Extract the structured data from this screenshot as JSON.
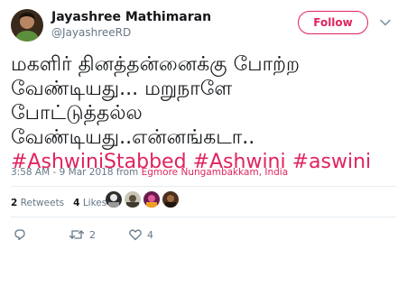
{
  "user": {
    "name": "Jayashree Mathimaran",
    "handle": "@JayashreeRD"
  },
  "follow_label": "Follow",
  "tweet": {
    "lines": [
      "மகளிர் தினத்தன்னைக்கு போற்ற",
      "வேண்டியது... மறுநாளே",
      "போட்டுத்தல்ல",
      "வேண்டியது..என்னங்கடா.."
    ],
    "hashtags": [
      "#AshwiniStabbed",
      "#Ashwini",
      "#aswini"
    ]
  },
  "meta": {
    "time": "3:58 AM - 9 Mar 2018 from ",
    "location": "Egmore Nungambakkam, India"
  },
  "stats": {
    "retweets_count": "2",
    "retweets_label": "Retweets",
    "likes_count": "4",
    "likes_label": "Likes"
  },
  "actions": {
    "retweet_count": "2",
    "like_count": "4"
  },
  "icons": {
    "reply": "reply-icon",
    "retweet": "retweet-icon",
    "like": "heart-icon",
    "caret": "chevron-down-icon"
  },
  "colors": {
    "accent": "#e0245e",
    "muted": "#657786",
    "text": "#14171a"
  }
}
